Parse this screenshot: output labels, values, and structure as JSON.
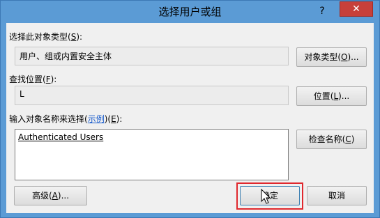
{
  "window": {
    "title": "选择用户或组",
    "help": "?",
    "close": "✕"
  },
  "object_type": {
    "label": "选择此对象类型(",
    "accel": "S",
    "label_end": "):",
    "value": "用户、组或内置安全主体",
    "button_label": "对象类型(",
    "button_accel": "O",
    "button_end": ")..."
  },
  "location": {
    "label": "查找位置(",
    "accel": "F",
    "label_end": "):",
    "value": "L",
    "button_label": "位置(",
    "button_accel": "L",
    "button_end": ")..."
  },
  "names": {
    "label": "输入对象名称来选择(",
    "link": "示例",
    "label_mid": ")(",
    "accel": "E",
    "label_end": "):",
    "entered": "Authenticated Users",
    "check_label": "检查名称(",
    "check_accel": "C",
    "check_end": ")"
  },
  "footer": {
    "advanced_label": "高级(",
    "advanced_accel": "A",
    "advanced_end": ")...",
    "ok_label": "确定",
    "cancel_label": "取消"
  }
}
